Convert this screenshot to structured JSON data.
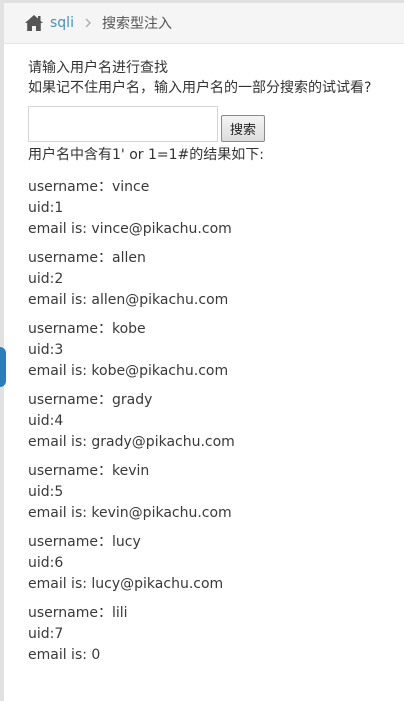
{
  "breadcrumb": {
    "root_label": "sqli",
    "current_label": "搜索型注入"
  },
  "intro": {
    "line1": "请输入用户名进行查找",
    "line2": "如果记不住用户名，输入用户名的一部分搜索的试试看?"
  },
  "search": {
    "value": "",
    "placeholder": "",
    "button_label": "搜索"
  },
  "result_title": "用户名中含有1' or 1=1#的结果如下:",
  "records": [
    {
      "username_line": "username：vince",
      "uid_line": "uid:1",
      "email_line": "email is: vince@pikachu.com"
    },
    {
      "username_line": "username：allen",
      "uid_line": "uid:2",
      "email_line": "email is: allen@pikachu.com"
    },
    {
      "username_line": "username：kobe",
      "uid_line": "uid:3",
      "email_line": "email is: kobe@pikachu.com"
    },
    {
      "username_line": "username：grady",
      "uid_line": "uid:4",
      "email_line": "email is: grady@pikachu.com"
    },
    {
      "username_line": "username：kevin",
      "uid_line": "uid:5",
      "email_line": "email is: kevin@pikachu.com"
    },
    {
      "username_line": "username：lucy",
      "uid_line": "uid:6",
      "email_line": "email is: lucy@pikachu.com"
    },
    {
      "username_line": "username：lili",
      "uid_line": "uid:7",
      "email_line": "email is: 0"
    }
  ],
  "colors": {
    "link": "#4c8fbd",
    "text": "#393939",
    "breadcrumb_bg": "#f5f5f5",
    "sidebar_accent": "#2b7dbc"
  },
  "icons": {
    "home": "home-icon",
    "separator": "chevron-right-icon"
  }
}
